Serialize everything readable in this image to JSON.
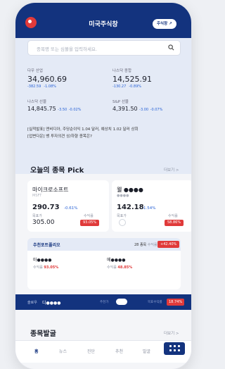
{
  "app": {
    "title": "미국주식창",
    "pill_label": "주식창 ↗"
  },
  "search": {
    "placeholder": "종목명 또는 심볼을 입력하세요."
  },
  "indices": [
    {
      "name": "다우 산업",
      "value": "34,960.69",
      "change": "-382.59",
      "percent": "-1.08%"
    },
    {
      "name": "나스닥 종합",
      "value": "14,525.91",
      "change": "-130.27",
      "percent": "-0.89%"
    },
    {
      "name": "나스닥 선물",
      "value": "14,845.75",
      "change": "-3.50",
      "percent": "-0.02%"
    },
    {
      "name": "S&P 선물",
      "value": "4,391.50",
      "change": "-3.00",
      "percent": "-0.07%"
    }
  ],
  "news": [
    "[실적발표] 엔비디아, 주당순이익 1.04 달러, 예상치 1.02 달러 상회",
    "[업변다운] 뱅 투자의견 상/하향 종목은?"
  ],
  "pick": {
    "title": "오늘의 종목 Pick",
    "more": "더보기 >",
    "cards": [
      {
        "name": "마이크로소프트",
        "ticker": "MSFT",
        "price": "290.73",
        "change": "-0.61%",
        "target_label": "목표가",
        "target": "305.00",
        "return_label": "수익률",
        "return": "93.05%"
      },
      {
        "name": "웰 ●●●●",
        "ticker": "●●●●",
        "price": "142.18",
        "change": "-1.54%",
        "target_label": "목표가",
        "target": "",
        "return_label": "수익률",
        "return": "58.86%"
      }
    ]
  },
  "portfolio": {
    "title": "추천포트폴리오",
    "count": "28 종목",
    "return_label": "수익률",
    "return": "+42.40%",
    "stocks": [
      {
        "name": "마●●●●",
        "label": "수익률",
        "return": "93.05%"
      },
      {
        "name": "메●●●●",
        "label": "수익률",
        "return": "48.85%"
      }
    ]
  },
  "band": {
    "label": "슬로우",
    "name": "디●●●●",
    "mid": "추천가",
    "right": "목표수익률",
    "return": "18.74%"
  },
  "issue": {
    "title": "종목발굴",
    "more": "더보기 >"
  },
  "nav": {
    "items": [
      "홈",
      "뉴스",
      "진단",
      "추천",
      "발굴"
    ]
  },
  "colors": {
    "brand": "#13337e",
    "up": "#e03a3a",
    "down": "#2a63d6"
  }
}
